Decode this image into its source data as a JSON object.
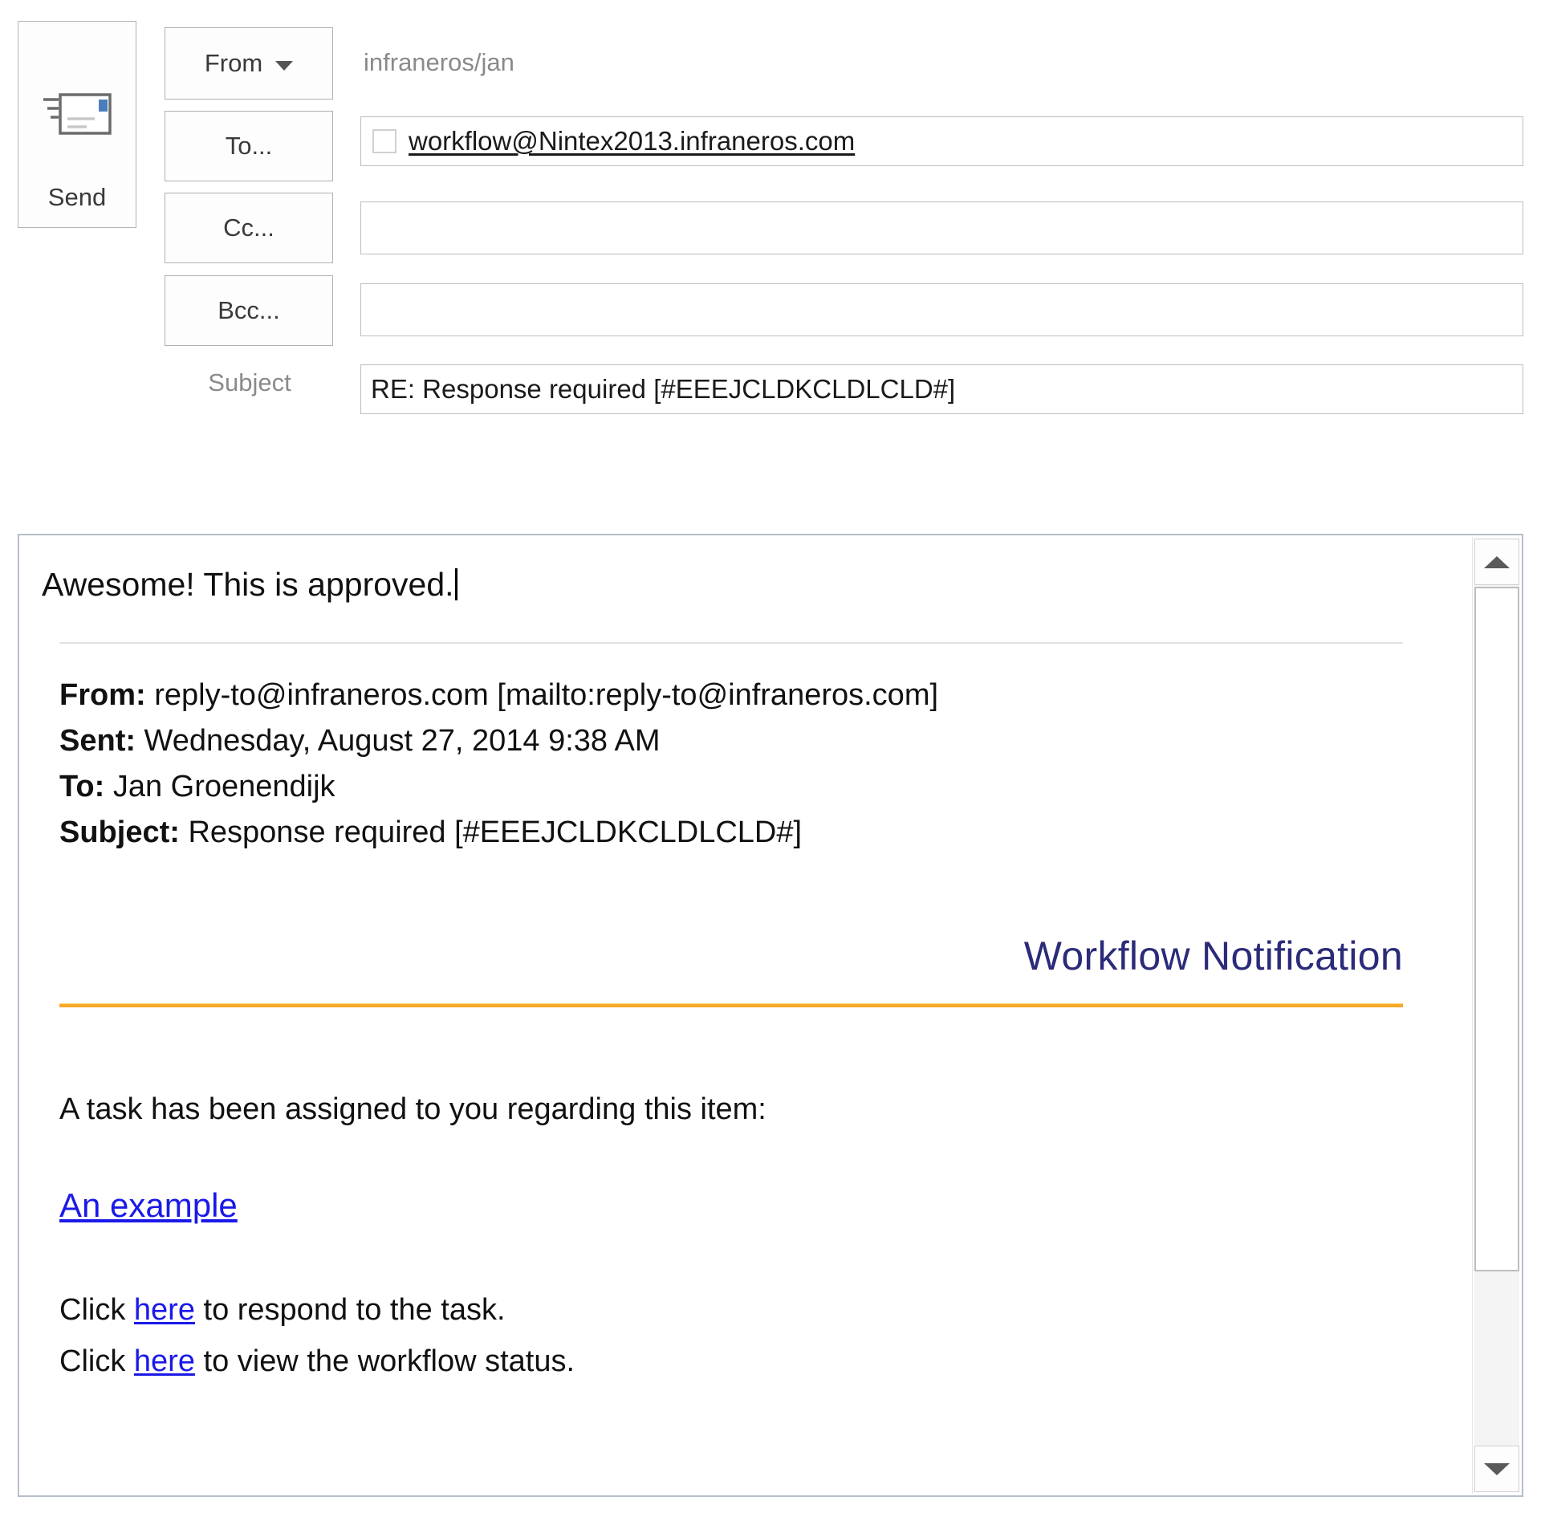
{
  "compose": {
    "send_label": "Send",
    "send_icon": "envelope-send-icon",
    "from_label": "From",
    "from_value": "infraneros/jan",
    "to_label": "To...",
    "cc_label": "Cc...",
    "bcc_label": "Bcc...",
    "subject_label": "Subject",
    "to_value": "workflow@Nintex2013.infraneros.com",
    "cc_value": "",
    "bcc_value": "",
    "subject_value": "RE: Response required [#EEEJCLDKCLDLCLD#]"
  },
  "body": {
    "reply_text": "Awesome! This is approved.",
    "quoted": {
      "from_key": "From:",
      "from_value": " reply-to@infraneros.com [mailto:reply-to@infraneros.com]",
      "sent_key": "Sent:",
      "sent_value": " Wednesday, August 27, 2014 9:38 AM",
      "to_key": "To:",
      "to_value": " Jan Groenendijk",
      "subject_key": "Subject:",
      "subject_value": " Response required [#EEEJCLDKCLDLCLD#]"
    },
    "notification_title": "Workflow Notification",
    "task_sentence": "A task has been assigned to you regarding this item:",
    "item_link": "An example",
    "respond_prefix": "Click ",
    "respond_link": "here",
    "respond_suffix": " to respond to the task.",
    "status_prefix": "Click ",
    "status_link": "here",
    "status_suffix": " to view the workflow status."
  },
  "scrollbar": {
    "up_icon": "chevron-up-icon",
    "down_icon": "chevron-down-icon"
  },
  "colors": {
    "notification_title": "#2b2b7a",
    "divider_orange": "#f9a825",
    "link_blue": "#1a19e8"
  }
}
